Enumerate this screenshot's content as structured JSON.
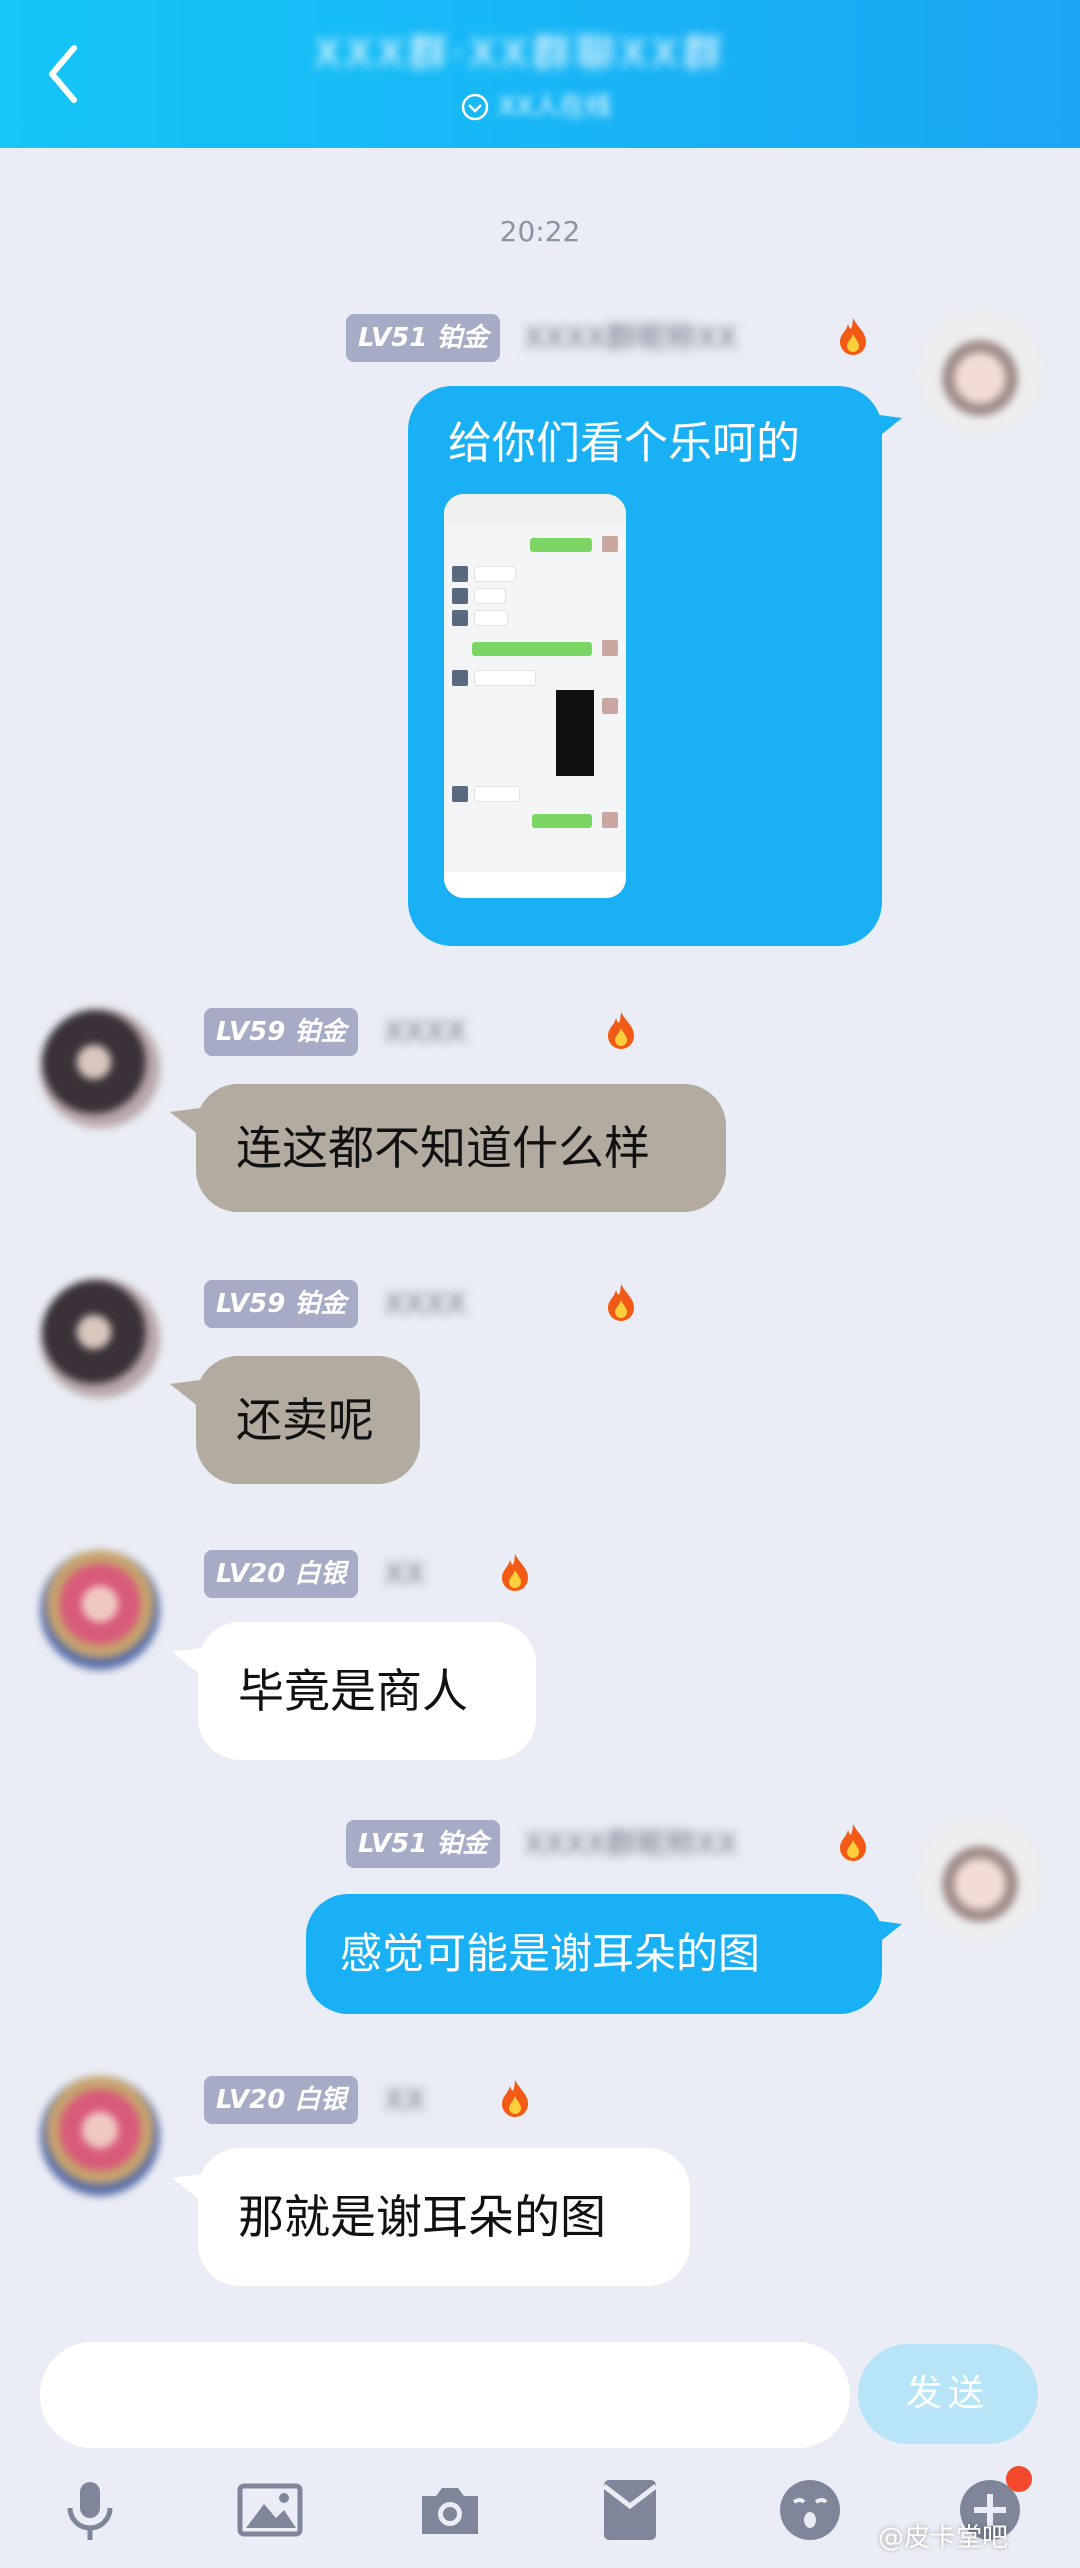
{
  "header": {
    "title": "XXX群·XX群聊XX群",
    "subtitle": "XX人在线",
    "colors": {
      "start": "#15c6f7",
      "end": "#1aa6f4"
    }
  },
  "chat": {
    "timestamp": "20:22",
    "messages": [
      {
        "side": "right",
        "level": "LV51 铂金",
        "nickname": "XXXX群昵称XX",
        "text": "给你们看个乐呵的",
        "has_image": true
      },
      {
        "side": "left",
        "level": "LV59 铂金",
        "nickname": "XXXX",
        "text": "连这都不知道什么样"
      },
      {
        "side": "left",
        "level": "LV59 铂金",
        "nickname": "XXXX",
        "text": "还卖呢"
      },
      {
        "side": "left",
        "level": "LV20 白银",
        "nickname": "XX",
        "text": "毕竟是商人"
      },
      {
        "side": "right",
        "level": "LV51 铂金",
        "nickname": "XXXX群昵称XX",
        "text": "感觉可能是谢耳朵的图"
      },
      {
        "side": "left",
        "level": "LV20 白银",
        "nickname": "XX",
        "text": "那就是谢耳朵的图"
      }
    ]
  },
  "input": {
    "placeholder": "",
    "send_label": "发送"
  },
  "toolbar": [
    "mic-icon",
    "image-icon",
    "camera-icon",
    "redpacket-icon",
    "emoji-icon",
    "plus-icon"
  ],
  "watermark": "@皮卡堂吧"
}
